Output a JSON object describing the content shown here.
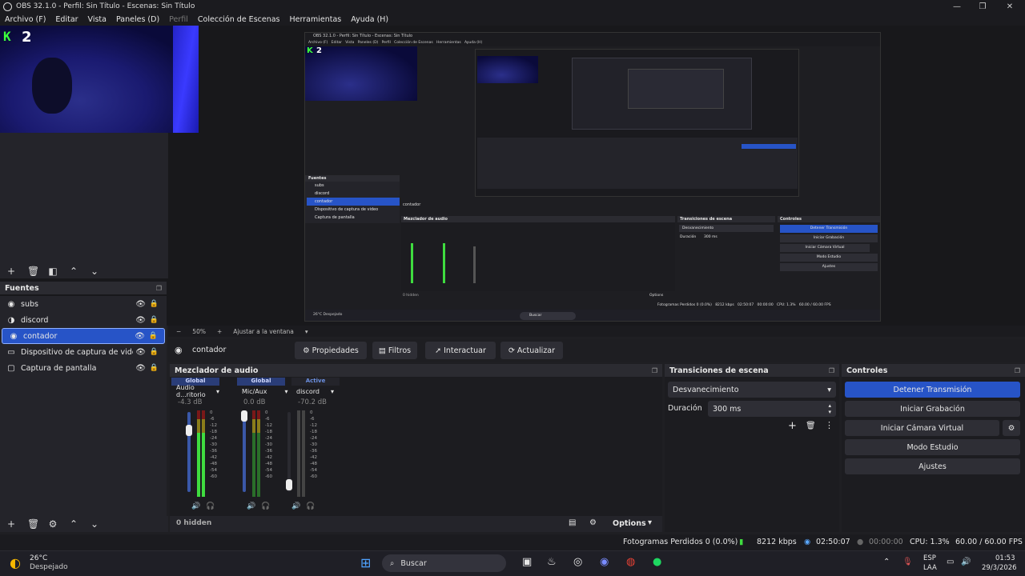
{
  "window": {
    "title": "OBS 32.1.0 - Perfil: Sin Título - Escenas: Sin Título",
    "min_glyph": "—",
    "max_glyph": "❐",
    "close_glyph": "✕"
  },
  "menu": [
    {
      "label": "Archivo (F)",
      "enabled": true
    },
    {
      "label": "Editar",
      "enabled": true
    },
    {
      "label": "Vista",
      "enabled": true
    },
    {
      "label": "Paneles (D)",
      "enabled": true
    },
    {
      "label": "Perfil",
      "enabled": false
    },
    {
      "label": "Colección de Escenas",
      "enabled": true
    },
    {
      "label": "Herramientas",
      "enabled": true
    },
    {
      "label": "Ayuda (H)",
      "enabled": true
    }
  ],
  "preview": {
    "counter_icon": "K",
    "counter_value": "2",
    "nested": {
      "title": "OBS 32.1.0 - Perfil: Sin Título - Escenas: Sin Título",
      "menu": "Archivo (F)   Editar   Vista   Paneles (D)   Perfil   Colección de Escenas   Herramientas   Ayuda (H)",
      "fuentes": "Fuentes",
      "sources": [
        "subs",
        "discord",
        "contador",
        "Dispositivo de captura de video",
        "Captura de pantalla"
      ],
      "context_source": "contador",
      "mixer": "Mezclador de audio",
      "transitions": "Transiciones de escena",
      "controls": "Controles",
      "stop": "Detener Transmisión",
      "rec": "Iniciar Grabación",
      "vcam": "Iniciar Cámara Virtual",
      "studio": "Modo Estudio",
      "settings": "Ajustes",
      "fade": "Desvanecimiento",
      "duration": "Duración",
      "ms": "300 ms",
      "hidden": "0 hidden",
      "options": "Options",
      "status": "Fotogramas Perdidos 0 (0.0%)   8212 kbps   02:50:07   00:00:00   CPU: 1.3%   60.00 / 60.00 FPS",
      "buscar": "Buscar",
      "weather": "26°C Despejado"
    }
  },
  "zoom": {
    "minus": "−",
    "value": "50%",
    "plus": "+",
    "fit": "Ajustar a la ventana"
  },
  "sources_panel": {
    "title": "Fuentes",
    "items": [
      {
        "label": "subs",
        "icon": "subs-icon",
        "selected": false
      },
      {
        "label": "discord",
        "icon": "audio-icon",
        "selected": false
      },
      {
        "label": "contador",
        "icon": "counter-icon",
        "selected": true
      },
      {
        "label": "Dispositivo de captura de video",
        "icon": "camera-icon",
        "selected": false
      },
      {
        "label": "Captura de pantalla",
        "icon": "monitor-icon",
        "selected": false
      }
    ]
  },
  "context": {
    "source": "contador",
    "properties": "Propiedades",
    "filters": "Filtros",
    "interact": "Interactuar",
    "refresh": "Actualizar"
  },
  "mixer": {
    "title": "Mezclador de audio",
    "channels": [
      {
        "tag": "Global",
        "name": "Audio d...ritorio",
        "db": "-4.3 dB",
        "active": true,
        "fader": 0.78
      },
      {
        "tag": "Global",
        "name": "Mic/Aux",
        "db": "0.0 dB",
        "active": true,
        "fader": 0.95
      },
      {
        "tag": "Active",
        "name": "discord",
        "db": "-70.2 dB",
        "active": true,
        "fader": 0.12
      }
    ],
    "ticks": [
      "0",
      "-6",
      "-12",
      "-18",
      "-24",
      "-30",
      "-36",
      "-42",
      "-48",
      "-54",
      "-60"
    ],
    "hidden": "0 hidden",
    "options": "Options"
  },
  "transitions": {
    "title": "Transiciones de escena",
    "selected": "Desvanecimiento",
    "duration_label": "Duración",
    "duration_value": "300 ms"
  },
  "controls": {
    "title": "Controles",
    "stop_stream": "Detener Transmisión",
    "start_record": "Iniciar Grabación",
    "start_vcam": "Iniciar Cámara Virtual",
    "studio_mode": "Modo Estudio",
    "settings": "Ajustes"
  },
  "status": {
    "dropped": "Fotogramas Perdidos 0 (0.0%)",
    "bitrate": "8212 kbps",
    "stream_time": "02:50:07",
    "rec_time": "00:00:00",
    "cpu": "CPU: 1.3%",
    "fps": "60.00 / 60.00 FPS"
  },
  "taskbar": {
    "temp": "26°C",
    "weather": "Despejado",
    "search": "Buscar",
    "lang1": "ESP",
    "lang2": "LAA",
    "time": "01:53",
    "date": "29/3/2026"
  },
  "colors": {
    "accent": "#2754c7",
    "panel": "#1c1c20",
    "header": "#2b2b31",
    "green": "#3cff3c"
  }
}
